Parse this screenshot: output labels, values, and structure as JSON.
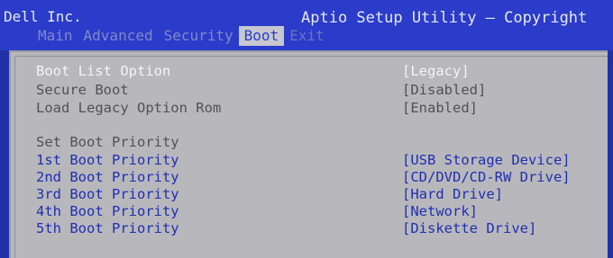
{
  "header": {
    "vendor": "Dell Inc.",
    "title": "Aptio Setup Utility – Copyright"
  },
  "tabs": [
    {
      "label": "Main"
    },
    {
      "label": "Advanced"
    },
    {
      "label": "Security"
    },
    {
      "label": "Boot"
    },
    {
      "label": "Exit"
    }
  ],
  "settings": [
    {
      "label": "Boot List Option",
      "value": "[Legacy]"
    },
    {
      "label": "Secure Boot",
      "value": "[Disabled]"
    },
    {
      "label": "Load Legacy Option Rom",
      "value": "[Enabled]"
    }
  ],
  "priority_header": "Set Boot Priority",
  "priorities": [
    {
      "label": "1st Boot Priority",
      "value": "[USB Storage Device]"
    },
    {
      "label": "2nd Boot Priority",
      "value": "[CD/DVD/CD-RW Drive]"
    },
    {
      "label": "3rd Boot Priority",
      "value": "[Hard Drive]"
    },
    {
      "label": "4th Boot Priority",
      "value": "[Network]"
    },
    {
      "label": "5th Boot Priority",
      "value": "[Diskette Drive]"
    }
  ],
  "colors": {
    "header_bg": "#2a3cc9",
    "panel_bg": "#b8b8bc",
    "selected_text": "#f4f4f6",
    "disabled_text": "#505058",
    "link_text": "#1f2fb0"
  }
}
